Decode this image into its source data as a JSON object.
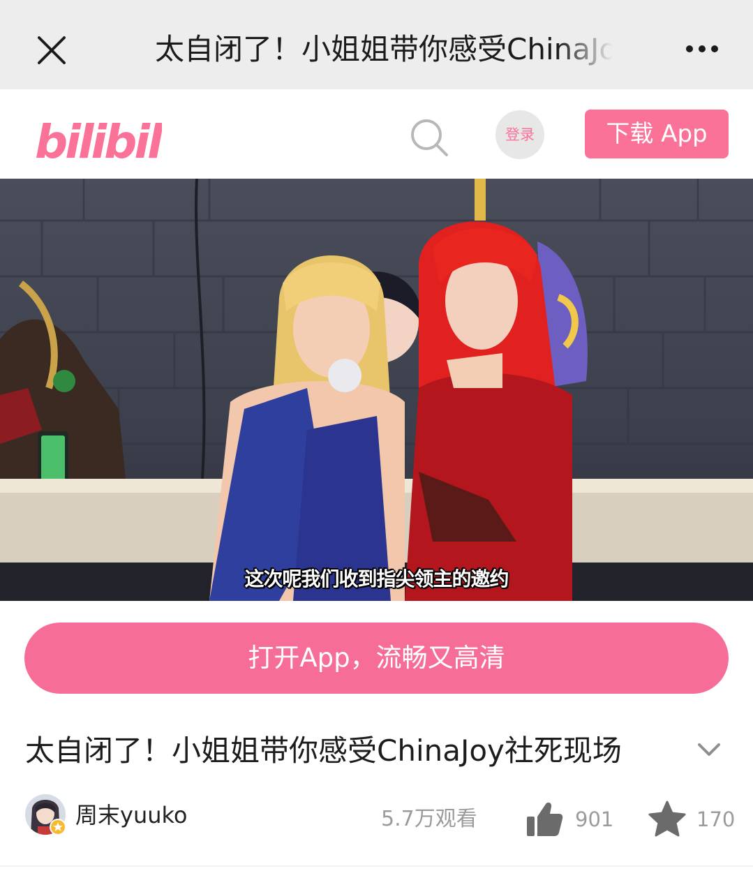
{
  "topbar": {
    "title": "太自闭了！小姐姐带你感受ChinaJoy社死现场",
    "close_icon": "close-icon",
    "more_icon": "more-dots-icon"
  },
  "header": {
    "logo_text": "bilibili",
    "search_icon": "search-icon",
    "login_label": "登录",
    "download_label": "下载 App",
    "brand_color": "#fb7299"
  },
  "video": {
    "subtitle": "这次呢我们收到指尖领主的邀约"
  },
  "open_app": {
    "label": "打开App，流畅又高清"
  },
  "info": {
    "title": "太自闭了！小姐姐带你感受ChinaJoy社死现场",
    "expand_icon": "chevron-down-icon"
  },
  "meta": {
    "author": "周末yuuko",
    "views": "5.7万观看",
    "likes": "901",
    "favorites": "170",
    "like_icon": "thumbs-up-icon",
    "favorite_icon": "star-icon"
  }
}
